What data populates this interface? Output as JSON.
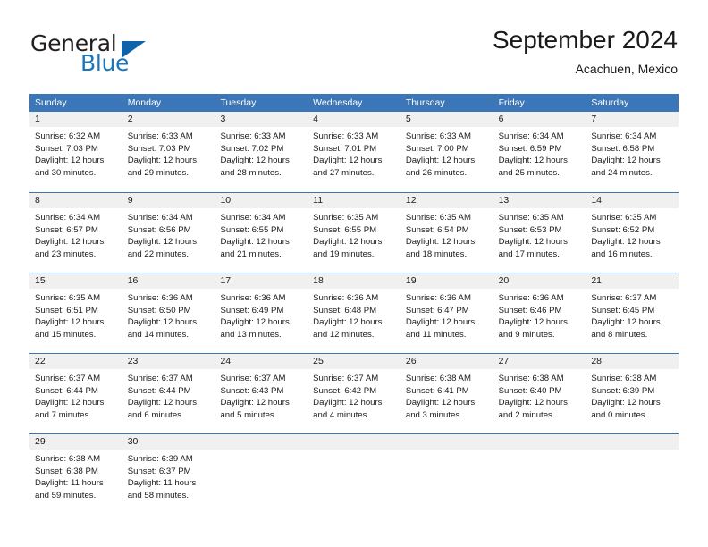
{
  "brand": {
    "word1": "General",
    "word2": "Blue",
    "triangle_icon": "triangle-icon",
    "accent_color": "#1b75bb"
  },
  "header": {
    "month_title": "September 2024",
    "location": "Acachuen, Mexico"
  },
  "theme": {
    "header_blue": "#3a76b8",
    "date_band_gray": "#f0f0f0",
    "text_color": "#1a1a1a"
  },
  "weekdays": [
    "Sunday",
    "Monday",
    "Tuesday",
    "Wednesday",
    "Thursday",
    "Friday",
    "Saturday"
  ],
  "weeks": [
    [
      {
        "day": "1",
        "lines": [
          "Sunrise: 6:32 AM",
          "Sunset: 7:03 PM",
          "Daylight: 12 hours",
          "and 30 minutes."
        ]
      },
      {
        "day": "2",
        "lines": [
          "Sunrise: 6:33 AM",
          "Sunset: 7:03 PM",
          "Daylight: 12 hours",
          "and 29 minutes."
        ]
      },
      {
        "day": "3",
        "lines": [
          "Sunrise: 6:33 AM",
          "Sunset: 7:02 PM",
          "Daylight: 12 hours",
          "and 28 minutes."
        ]
      },
      {
        "day": "4",
        "lines": [
          "Sunrise: 6:33 AM",
          "Sunset: 7:01 PM",
          "Daylight: 12 hours",
          "and 27 minutes."
        ]
      },
      {
        "day": "5",
        "lines": [
          "Sunrise: 6:33 AM",
          "Sunset: 7:00 PM",
          "Daylight: 12 hours",
          "and 26 minutes."
        ]
      },
      {
        "day": "6",
        "lines": [
          "Sunrise: 6:34 AM",
          "Sunset: 6:59 PM",
          "Daylight: 12 hours",
          "and 25 minutes."
        ]
      },
      {
        "day": "7",
        "lines": [
          "Sunrise: 6:34 AM",
          "Sunset: 6:58 PM",
          "Daylight: 12 hours",
          "and 24 minutes."
        ]
      }
    ],
    [
      {
        "day": "8",
        "lines": [
          "Sunrise: 6:34 AM",
          "Sunset: 6:57 PM",
          "Daylight: 12 hours",
          "and 23 minutes."
        ]
      },
      {
        "day": "9",
        "lines": [
          "Sunrise: 6:34 AM",
          "Sunset: 6:56 PM",
          "Daylight: 12 hours",
          "and 22 minutes."
        ]
      },
      {
        "day": "10",
        "lines": [
          "Sunrise: 6:34 AM",
          "Sunset: 6:55 PM",
          "Daylight: 12 hours",
          "and 21 minutes."
        ]
      },
      {
        "day": "11",
        "lines": [
          "Sunrise: 6:35 AM",
          "Sunset: 6:55 PM",
          "Daylight: 12 hours",
          "and 19 minutes."
        ]
      },
      {
        "day": "12",
        "lines": [
          "Sunrise: 6:35 AM",
          "Sunset: 6:54 PM",
          "Daylight: 12 hours",
          "and 18 minutes."
        ]
      },
      {
        "day": "13",
        "lines": [
          "Sunrise: 6:35 AM",
          "Sunset: 6:53 PM",
          "Daylight: 12 hours",
          "and 17 minutes."
        ]
      },
      {
        "day": "14",
        "lines": [
          "Sunrise: 6:35 AM",
          "Sunset: 6:52 PM",
          "Daylight: 12 hours",
          "and 16 minutes."
        ]
      }
    ],
    [
      {
        "day": "15",
        "lines": [
          "Sunrise: 6:35 AM",
          "Sunset: 6:51 PM",
          "Daylight: 12 hours",
          "and 15 minutes."
        ]
      },
      {
        "day": "16",
        "lines": [
          "Sunrise: 6:36 AM",
          "Sunset: 6:50 PM",
          "Daylight: 12 hours",
          "and 14 minutes."
        ]
      },
      {
        "day": "17",
        "lines": [
          "Sunrise: 6:36 AM",
          "Sunset: 6:49 PM",
          "Daylight: 12 hours",
          "and 13 minutes."
        ]
      },
      {
        "day": "18",
        "lines": [
          "Sunrise: 6:36 AM",
          "Sunset: 6:48 PM",
          "Daylight: 12 hours",
          "and 12 minutes."
        ]
      },
      {
        "day": "19",
        "lines": [
          "Sunrise: 6:36 AM",
          "Sunset: 6:47 PM",
          "Daylight: 12 hours",
          "and 11 minutes."
        ]
      },
      {
        "day": "20",
        "lines": [
          "Sunrise: 6:36 AM",
          "Sunset: 6:46 PM",
          "Daylight: 12 hours",
          "and 9 minutes."
        ]
      },
      {
        "day": "21",
        "lines": [
          "Sunrise: 6:37 AM",
          "Sunset: 6:45 PM",
          "Daylight: 12 hours",
          "and 8 minutes."
        ]
      }
    ],
    [
      {
        "day": "22",
        "lines": [
          "Sunrise: 6:37 AM",
          "Sunset: 6:44 PM",
          "Daylight: 12 hours",
          "and 7 minutes."
        ]
      },
      {
        "day": "23",
        "lines": [
          "Sunrise: 6:37 AM",
          "Sunset: 6:44 PM",
          "Daylight: 12 hours",
          "and 6 minutes."
        ]
      },
      {
        "day": "24",
        "lines": [
          "Sunrise: 6:37 AM",
          "Sunset: 6:43 PM",
          "Daylight: 12 hours",
          "and 5 minutes."
        ]
      },
      {
        "day": "25",
        "lines": [
          "Sunrise: 6:37 AM",
          "Sunset: 6:42 PM",
          "Daylight: 12 hours",
          "and 4 minutes."
        ]
      },
      {
        "day": "26",
        "lines": [
          "Sunrise: 6:38 AM",
          "Sunset: 6:41 PM",
          "Daylight: 12 hours",
          "and 3 minutes."
        ]
      },
      {
        "day": "27",
        "lines": [
          "Sunrise: 6:38 AM",
          "Sunset: 6:40 PM",
          "Daylight: 12 hours",
          "and 2 minutes."
        ]
      },
      {
        "day": "28",
        "lines": [
          "Sunrise: 6:38 AM",
          "Sunset: 6:39 PM",
          "Daylight: 12 hours",
          "and 0 minutes."
        ]
      }
    ],
    [
      {
        "day": "29",
        "lines": [
          "Sunrise: 6:38 AM",
          "Sunset: 6:38 PM",
          "Daylight: 11 hours",
          "and 59 minutes."
        ]
      },
      {
        "day": "30",
        "lines": [
          "Sunrise: 6:39 AM",
          "Sunset: 6:37 PM",
          "Daylight: 11 hours",
          "and 58 minutes."
        ]
      },
      {
        "day": "",
        "lines": []
      },
      {
        "day": "",
        "lines": []
      },
      {
        "day": "",
        "lines": []
      },
      {
        "day": "",
        "lines": []
      },
      {
        "day": "",
        "lines": []
      }
    ]
  ]
}
